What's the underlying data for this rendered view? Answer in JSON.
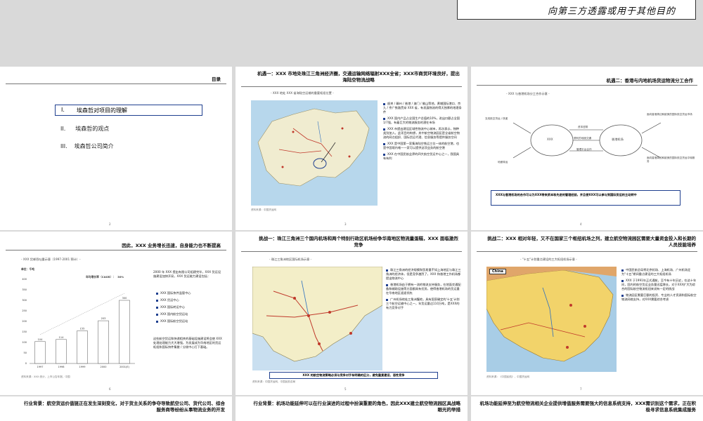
{
  "header": {
    "confidential": "向第三方透露或用于其他目的"
  },
  "slides": {
    "s1": {
      "title": "目录",
      "items": [
        {
          "num": "I.",
          "label": "埃森哲对项目的理解"
        },
        {
          "num": "II.",
          "label": "埃森哲的观点"
        },
        {
          "num": "III.",
          "label": "埃森哲公司简介"
        }
      ],
      "page": "2"
    },
    "s2": {
      "title": "机遇一：XXX 市地处珠江三角洲经济圈，交通运输网络辐射XXX全省；XXX市商贸环境良好，提出海陆空物流战略",
      "subtitle": "- XXX 地处 XXX 省海陆空运输的重要枢纽位置 -",
      "bullets": [
        "韶关 / 赣州 / 香港 / 澳门 / 佛山等地，黄埔国际港口、京九 / 京广铁路贯穿 XXX 省，有发展物流的得天独厚的地理条件",
        "XXX 国内产品占全国生产总值的10%，进出口额占全国1/7强，有着巨大的物流服务的潜在市场",
        "XXX 市提出建设区域性物流中心城市，再次表示，物种类别加入，此项目的构想，其中航空物流园区是全省航空物流的网点组织、国际货运代理、信息服务等提供服务空间",
        "XXX 是中国第一家集海陆空铁运三位一体的航空港，也是中国境内唯一一家可以提供这项业务的航空港",
        "XXX 在中国民航业界的四大航空货运中心之一，我国具有有利"
      ],
      "source": "资料来源：中国货运网",
      "page": "3"
    },
    "s3": {
      "title": "机遇二：香港与内地机场货运物流分工合作",
      "subtitle": "- XXX 与香港机场分工合作示意 -",
      "left_oval": "XXX",
      "right_oval": "香港机场",
      "links": [
        "资本纽带",
        "便利的地面交通",
        "管理平台合作"
      ],
      "corners": [
        "支线航空货运 / 快递",
        "面向香港周边和欧美的国际航空货运市场",
        "地面转运",
        "面向香港周边和欧美的国际航空货运中转服务"
      ],
      "banner": "XXX与香港机场的合作可以为XXX带来资本和先进的管理经验，并且使XXX可以参与到国际货运的主动转中",
      "page": "4"
    },
    "s4": {
      "title": "因此，XXX 业务增长迅速，自身能力也不断提高",
      "subtitle": "- XXX 货邮吞吐量示意（1997-2001 预计）-",
      "unit": "单位：千吨",
      "cagr_label": "年均增长率（CAGR）：",
      "cagr_value": "30%",
      "text": "2000 年 XXX 提出有限公司组建完毕，XXX 货运设施建设加快开局，XXX 货运能力建设包括：",
      "bullets": [
        "XXX 国际快件监管中心",
        "XXX 货运中心",
        "XXX 国际转运中心",
        "XXX 国内航空货运站",
        "XXX 国际航空货运站"
      ],
      "footnote": "这些航空货运和快递相关的基础设施建设将会使 XXX 处理处理能力大大增强，为发展成为华南地区的货运枢纽和国际快件集散 / 分拨中心打下基础。",
      "source": "资料来源：XXX 统计，上市公告年报，中国",
      "page": "6",
      "chart_data": {
        "type": "bar",
        "categories": [
          "1997",
          "1998",
          "1999",
          "2000",
          "2001(E)"
        ],
        "values": [
          104,
          114,
          155,
          203,
          300
        ],
        "ylim": [
          0,
          400
        ],
        "yticks": [
          "0",
          "50",
          "100",
          "150",
          "200",
          "250",
          "300",
          "350",
          "400"
        ]
      }
    },
    "s5": {
      "title": "挑战一：珠江三角洲三个国内机场和两个特别行政区机场纷争华南地区物流量蛋糕，XXX 面临激烈竞争",
      "subtitle": "- 珠江三角洲地区国际机场示意 -",
      "bullets": [
        "珠江三角洲的经济规模和贸易量不如上海地区与珠江三角洲的经济体，但是竞争激烈了，XXX 和香港工作机场都提出物流中心",
        "香港机场由于拥有一流的物流支持服务，在地面交通配备和辅助设施等方面都具有优势，使得香港机场的货运量在华南地区遥遥领先",
        "广州机场地处三角洲腹地，具有国家确定的'十五'计划三个航空运输中心之一，年货运量达110万吨，是XXX的有力竞争对手"
      ],
      "banner": "XXX 的航空物流策略必须与竞争对手有明确的区分，避免重复建设、恶性竞争",
      "source": "资料来源：中国货运网，中国民航总局",
      "page": "5"
    },
    "s6": {
      "title": "挑战二：XXX 相对年轻，又不在国家三个枢纽机场之列，建立航空物流园区需要大量资金投入和长期的人员技能培养",
      "subtitle": "- \"十五\"计划重点建设的三大枢纽机场示意 -",
      "map_label": "China",
      "bullets": [
        "中国民航总局将北京机场、上海机场、广州机场定为\"十五\"期间重点建设的三大枢纽机场",
        "XXX 于1991年正式通航，至今有十年历史，在这十年间，国内的航空货运业务量迅猛增长，对于XXX扩大为综合的国际航空物流枢纽来说有一定的挑战",
        "物流园区需要巨额的投资、专业的人才资源和国际航空物流网络支持，对XXX需要综合考虑"
      ],
      "source": "资料来源：《中国民航》，中国货运网",
      "page": "7"
    },
    "s7": {
      "title": "行业背景：航空货运价值链正在发生深刻变化，对于货主关系的争夺导致航空公司、货代公司、综合服务商等纷纷从事物流业务的开发"
    },
    "s8": {
      "title": "行业背景：机场功能延伸可以在行业演进的过程中扮演重要的角色，因此XXX建立航空物流园区具战略眼光的举措"
    },
    "s9": {
      "title": "机场功能延伸至为航空物流相关企业提供增值服务需要强大的信息系统支持，XXX需识别这个需求，正在积极寻求信息系统集成服务"
    }
  }
}
